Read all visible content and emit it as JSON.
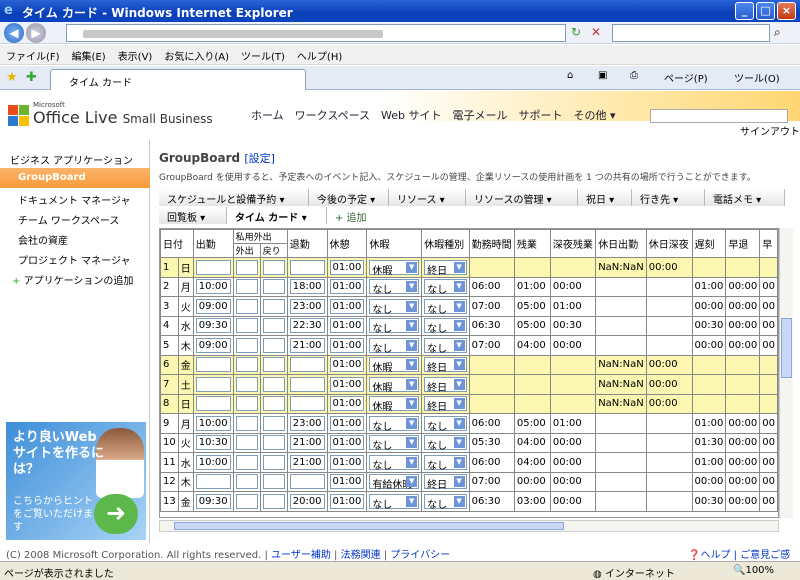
{
  "window": {
    "title": "タイム カード - Windows Internet Explorer",
    "min": "_",
    "max": "□",
    "close": "×"
  },
  "nav": {
    "back": "◀",
    "forward": "▶",
    "refresh": "↻",
    "stop": "✕",
    "search_btn": "⌕"
  },
  "menubar": [
    "ファイル(F)",
    "編集(E)",
    "表示(V)",
    "お気に入り(A)",
    "ツール(T)",
    "ヘルプ(H)"
  ],
  "tab": {
    "label": "タイム カード"
  },
  "toolbar": {
    "home": "⌂",
    "feeds": "▣",
    "print": "⎙",
    "page": "ページ(P)",
    "tools": "ツール(O)"
  },
  "header": {
    "brand_small": "Microsoft",
    "brand_main": "Office Live",
    "brand_sub": "Small Business",
    "nav": [
      "ホーム",
      "ワークスペース",
      "Web サイト",
      "電子メール",
      "サポート",
      "その他 ▾"
    ],
    "signout": "サインアウト"
  },
  "sidebar": {
    "heading": "ビジネス アプリケーション",
    "items": [
      "GroupBoard",
      "ドキュメント マネージャ",
      "チーム ワークスペース",
      "会社の資産",
      "プロジェクト マネージャ"
    ],
    "add_app": "アプリケーションの追加",
    "ad": {
      "headline": "より良いWebサイトを作るには？",
      "body": "こちらからヒントをご覧いただけます",
      "arrow": "➜"
    }
  },
  "main": {
    "title": "GroupBoard",
    "settings": "設定",
    "description": "GroupBoard を使用すると、予定表へのイベント記入、スケジュールの管理、企業リソースの使用計画を 1 つの共有の場所で行うことができます。",
    "tabs_row1": [
      "スケジュールと設備予約 ▾",
      "今後の予定 ▾",
      "リソース ▾",
      "リソースの管理 ▾",
      "祝日 ▾",
      "行き先 ▾",
      "電話メモ ▾"
    ],
    "tabs_row2": [
      "回覧板 ▾",
      "タイム カード ▾"
    ],
    "add": "+ 追加"
  },
  "timecard": {
    "headers": [
      "日付",
      "出勤",
      "私用外出",
      "退勤",
      "休憩",
      "休暇",
      "休暇種別",
      "勤務時間",
      "残業",
      "深夜残業",
      "休日出勤",
      "休日深夜",
      "遅刻",
      "早退",
      "早"
    ],
    "subheaders": [
      "外出",
      "戻り"
    ],
    "rows": [
      {
        "d": "1",
        "w": "日",
        "in": "",
        "out": "",
        "brk": "01:00",
        "leave": "休暇",
        "type": "終日",
        "work": "",
        "ot": "",
        "night": "",
        "hol": "NaN:NaN",
        "holn": "00:00",
        "late": "",
        "early": "",
        "x": "",
        "y": true
      },
      {
        "d": "2",
        "w": "月",
        "in": "10:00",
        "out": "18:00",
        "brk": "01:00",
        "leave": "なし",
        "type": "なし",
        "work": "06:00",
        "ot": "01:00",
        "night": "00:00",
        "hol": "",
        "holn": "",
        "late": "01:00",
        "early": "00:00",
        "x": "00",
        "y": false
      },
      {
        "d": "3",
        "w": "火",
        "in": "09:00",
        "out": "23:00",
        "brk": "01:00",
        "leave": "なし",
        "type": "なし",
        "work": "07:00",
        "ot": "05:00",
        "night": "01:00",
        "hol": "",
        "holn": "",
        "late": "00:00",
        "early": "00:00",
        "x": "00",
        "y": false
      },
      {
        "d": "4",
        "w": "水",
        "in": "09:30",
        "out": "22:30",
        "brk": "01:00",
        "leave": "なし",
        "type": "なし",
        "work": "06:30",
        "ot": "05:00",
        "night": "00:30",
        "hol": "",
        "holn": "",
        "late": "00:30",
        "early": "00:00",
        "x": "00",
        "y": false
      },
      {
        "d": "5",
        "w": "木",
        "in": "09:00",
        "out": "21:00",
        "brk": "01:00",
        "leave": "なし",
        "type": "なし",
        "work": "07:00",
        "ot": "04:00",
        "night": "00:00",
        "hol": "",
        "holn": "",
        "late": "00:00",
        "early": "00:00",
        "x": "00",
        "y": false
      },
      {
        "d": "6",
        "w": "金",
        "in": "",
        "out": "",
        "brk": "01:00",
        "leave": "休暇",
        "type": "終日",
        "work": "",
        "ot": "",
        "night": "",
        "hol": "NaN:NaN",
        "holn": "00:00",
        "late": "",
        "early": "",
        "x": "",
        "y": true
      },
      {
        "d": "7",
        "w": "土",
        "in": "",
        "out": "",
        "brk": "01:00",
        "leave": "休暇",
        "type": "終日",
        "work": "",
        "ot": "",
        "night": "",
        "hol": "NaN:NaN",
        "holn": "00:00",
        "late": "",
        "early": "",
        "x": "",
        "y": true
      },
      {
        "d": "8",
        "w": "日",
        "in": "",
        "out": "",
        "brk": "01:00",
        "leave": "休暇",
        "type": "終日",
        "work": "",
        "ot": "",
        "night": "",
        "hol": "NaN:NaN",
        "holn": "00:00",
        "late": "",
        "early": "",
        "x": "",
        "y": true
      },
      {
        "d": "9",
        "w": "月",
        "in": "10:00",
        "out": "23:00",
        "brk": "01:00",
        "leave": "なし",
        "type": "なし",
        "work": "06:00",
        "ot": "05:00",
        "night": "01:00",
        "hol": "",
        "holn": "",
        "late": "01:00",
        "early": "00:00",
        "x": "00",
        "y": false
      },
      {
        "d": "10",
        "w": "火",
        "in": "10:30",
        "out": "21:00",
        "brk": "01:00",
        "leave": "なし",
        "type": "なし",
        "work": "05:30",
        "ot": "04:00",
        "night": "00:00",
        "hol": "",
        "holn": "",
        "late": "01:30",
        "early": "00:00",
        "x": "00",
        "y": false
      },
      {
        "d": "11",
        "w": "水",
        "in": "10:00",
        "out": "21:00",
        "brk": "01:00",
        "leave": "なし",
        "type": "なし",
        "work": "06:00",
        "ot": "04:00",
        "night": "00:00",
        "hol": "",
        "holn": "",
        "late": "01:00",
        "early": "00:00",
        "x": "00",
        "y": false
      },
      {
        "d": "12",
        "w": "木",
        "in": "",
        "out": "",
        "brk": "01:00",
        "leave": "有給休暇",
        "type": "終日",
        "work": "07:00",
        "ot": "00:00",
        "night": "00:00",
        "hol": "",
        "holn": "",
        "late": "00:00",
        "early": "00:00",
        "x": "00",
        "y": false
      },
      {
        "d": "13",
        "w": "金",
        "in": "09:30",
        "out": "20:00",
        "brk": "01:00",
        "leave": "なし",
        "type": "なし",
        "work": "06:30",
        "ot": "03:00",
        "night": "00:00",
        "hol": "",
        "holn": "",
        "late": "00:30",
        "early": "00:00",
        "x": "00",
        "y": false
      }
    ]
  },
  "footer": {
    "copyright": "(C) 2008 Microsoft Corporation. All rights reserved.",
    "links": [
      "ユーザー補助",
      "法務関連",
      "プライバシー"
    ],
    "help": "ヘルプ",
    "feedback": "ご意見ご感想"
  },
  "statusbar": {
    "text": "ページが表示されました",
    "zone": "インターネット",
    "zoom": "100%"
  }
}
